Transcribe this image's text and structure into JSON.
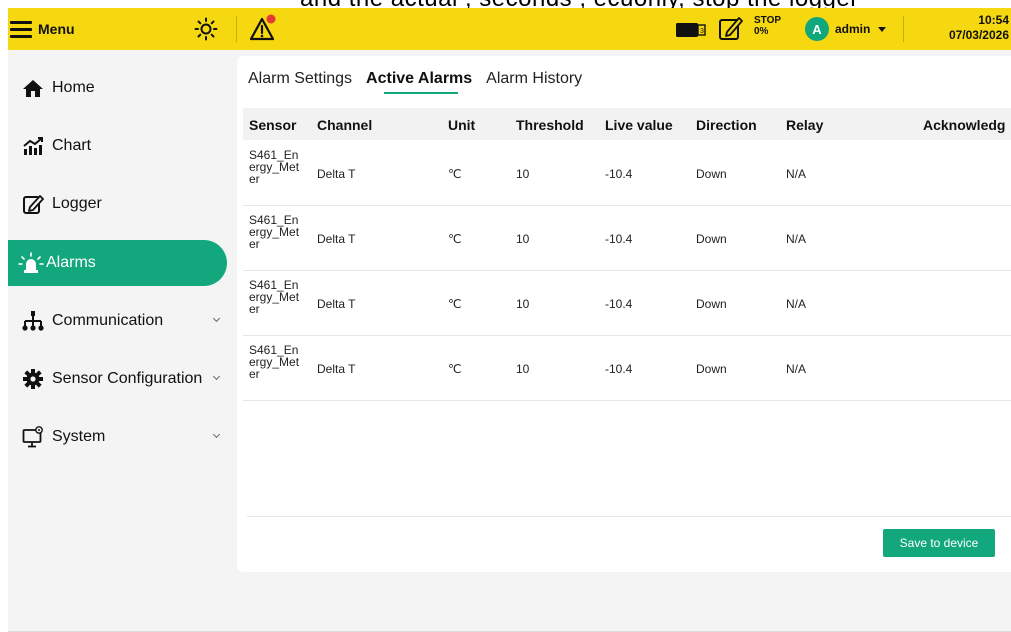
{
  "top_caption": "and the actual , seconds , ecuonly, stop the logger",
  "header": {
    "menu_label": "Menu",
    "record_status": "STOP",
    "record_percent": "0%",
    "user_initial": "A",
    "user_name": "admin",
    "time": "10:54",
    "date": "07/03/2026",
    "icons": [
      "hamburger-icon",
      "sun-icon",
      "warning-icon",
      "sd-card-icon",
      "edit-record-icon",
      "chevron-down-icon"
    ]
  },
  "sidebar": {
    "items": [
      {
        "label": "Home",
        "icon": "home-icon"
      },
      {
        "label": "Chart",
        "icon": "chart-icon"
      },
      {
        "label": "Logger",
        "icon": "logger-icon"
      },
      {
        "label": "Alarms",
        "icon": "alarm-icon",
        "active": true
      },
      {
        "label": "Communication",
        "icon": "network-icon"
      },
      {
        "label": "Sensor Configuration",
        "icon": "gear-icon"
      },
      {
        "label": "System",
        "icon": "monitor-icon"
      }
    ]
  },
  "tabs": [
    {
      "label": "Alarm Settings"
    },
    {
      "label": "Active Alarms",
      "active": true
    },
    {
      "label": "Alarm History"
    }
  ],
  "table": {
    "columns": [
      "Sensor",
      "Channel",
      "Unit",
      "Threshold",
      "Live value",
      "Direction",
      "Relay",
      "Acknowledg"
    ],
    "rows": [
      {
        "sensor": "S461_Energy_Meter",
        "channel": "Delta T",
        "unit": "℃",
        "threshold": "10",
        "live": "-10.4",
        "direction": "Down",
        "relay": "N/A"
      },
      {
        "sensor": "S461_Energy_Meter",
        "channel": "Delta T",
        "unit": "℃",
        "threshold": "10",
        "live": "-10.4",
        "direction": "Down",
        "relay": "N/A"
      },
      {
        "sensor": "S461_Energy_Meter",
        "channel": "Delta T",
        "unit": "℃",
        "threshold": "10",
        "live": "-10.4",
        "direction": "Down",
        "relay": "N/A"
      },
      {
        "sensor": "S461_Energy_Meter",
        "channel": "Delta T",
        "unit": "℃",
        "threshold": "10",
        "live": "-10.4",
        "direction": "Down",
        "relay": "N/A"
      }
    ]
  },
  "save_button": "Save to device",
  "colors": {
    "header": "#f5d80f",
    "accent": "#13a77d",
    "warning_dot": "#e53935"
  }
}
